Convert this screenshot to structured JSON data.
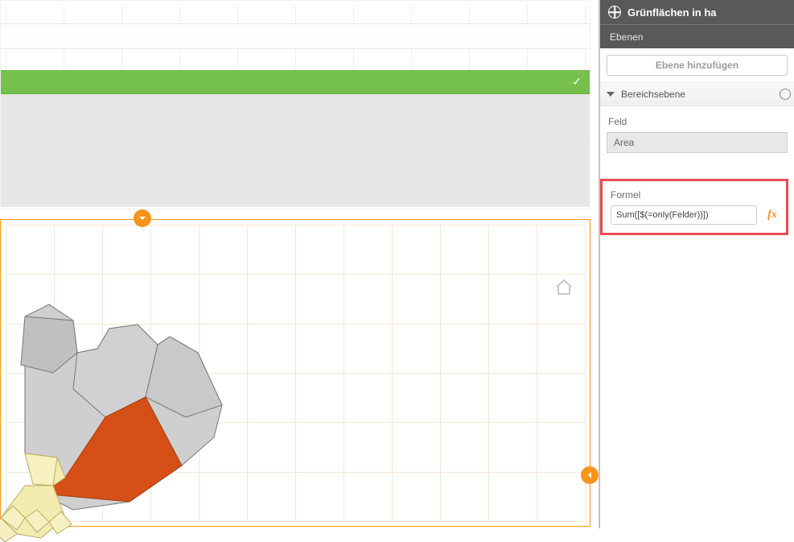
{
  "header": {
    "title": "Grünflächen in ha",
    "sub_layers": "Ebenen"
  },
  "sidebar": {
    "add_layer_label": "Ebene hinzufügen",
    "accordion_label": "Bereichsebene",
    "field_label": "Feld",
    "field_value": "Area",
    "formula_label": "Formel",
    "formula_value": "Sum([$(=only(Felder))])",
    "fx_label": "fx"
  },
  "icons": {
    "globe": "globe-icon",
    "home": "home-icon",
    "chevron_down": "chevron-down-icon",
    "chevron_left": "chevron-left-icon",
    "check": "check-icon",
    "help": "help-icon",
    "triangle": "triangle-icon"
  },
  "colors": {
    "accent": "#f7941e",
    "selected": "#76c04d",
    "highlight_border": "#ed4b55"
  }
}
